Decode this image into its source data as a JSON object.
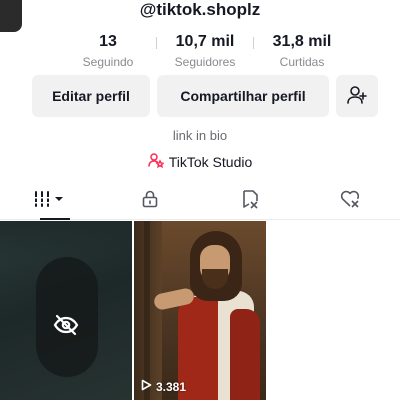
{
  "profile": {
    "handle": "@tiktok.shoplz",
    "bio": "link in bio",
    "studio_label": "TikTok Studio"
  },
  "stats": [
    {
      "value": "13",
      "label": "Seguindo"
    },
    {
      "value": "10,7 mil",
      "label": "Seguidores"
    },
    {
      "value": "31,8 mil",
      "label": "Curtidas"
    }
  ],
  "actions": {
    "edit_label": "Editar perfil",
    "share_label": "Compartilhar perfil",
    "add_friend_icon": "add-user-icon"
  },
  "tabs": [
    {
      "icon": "videos-grid-icon",
      "active": true
    },
    {
      "icon": "lock-icon",
      "active": false
    },
    {
      "icon": "reposts-icon",
      "active": false
    },
    {
      "icon": "liked-icon",
      "active": false
    }
  ],
  "videos": [
    {
      "private": true,
      "icon": "hidden-eye-icon"
    },
    {
      "private": false,
      "views": "3.381"
    }
  ],
  "colors": {
    "text": "#161823",
    "muted": "#8a8b91",
    "button_bg": "#f1f1f2",
    "studio_accent": "#fe2c55"
  }
}
